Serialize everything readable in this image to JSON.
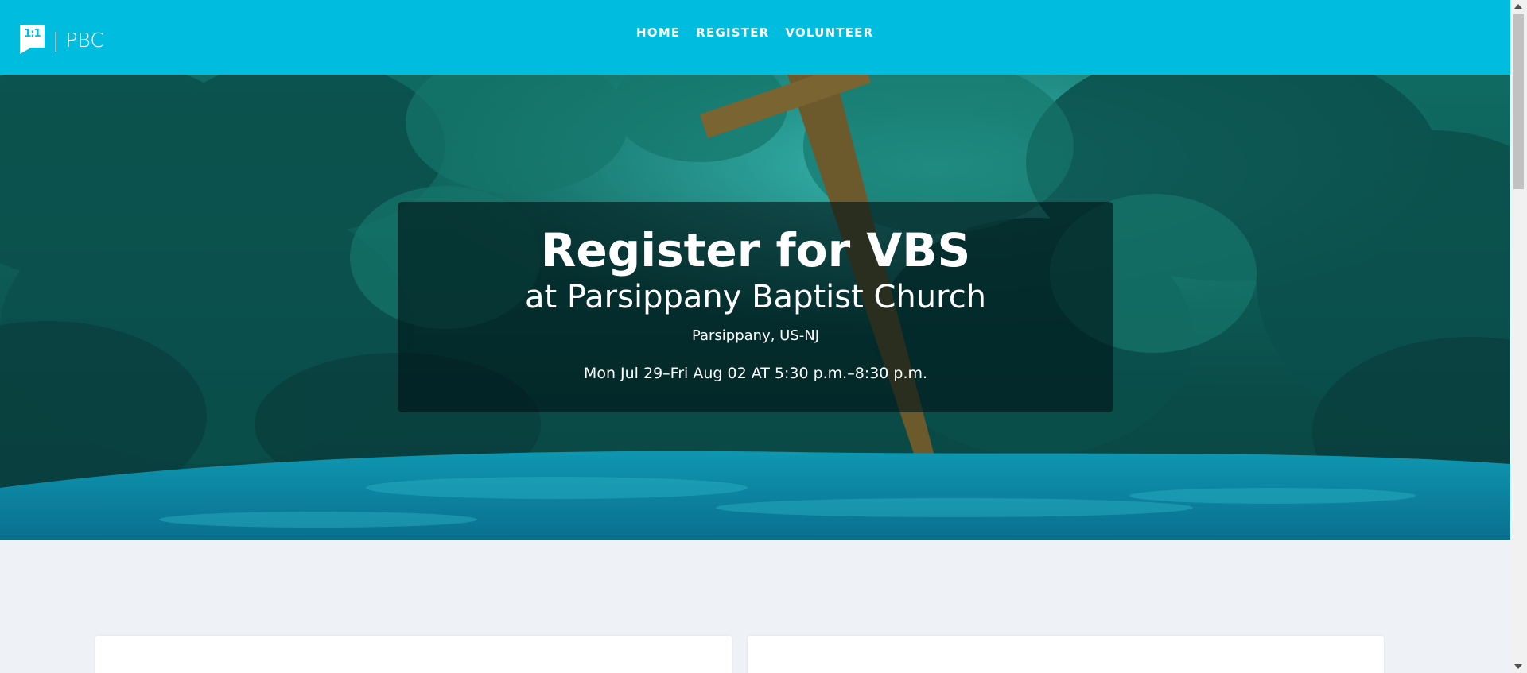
{
  "header": {
    "logo_mark": "1:1",
    "logo_text": "| PBC",
    "nav": [
      {
        "label": "HOME"
      },
      {
        "label": "REGISTER"
      },
      {
        "label": "VOLUNTEER"
      }
    ]
  },
  "hero": {
    "title": "Register for VBS",
    "subtitle": "at Parsippany Baptist Church",
    "location": "Parsippany, US-NJ",
    "dates": "Mon Jul 29–Fri Aug 02 AT 5:30 p.m.–8:30 p.m."
  },
  "colors": {
    "header_bg": "#00bde0",
    "page_bg": "#eef2f6",
    "hero_water": "#0a8aa6",
    "overlay": "rgba(0,20,22,0.62)"
  },
  "icons": {
    "logo": "speech-bubble-logo-icon",
    "scroll_up": "arrow-up-icon",
    "scroll_down": "arrow-down-icon"
  }
}
